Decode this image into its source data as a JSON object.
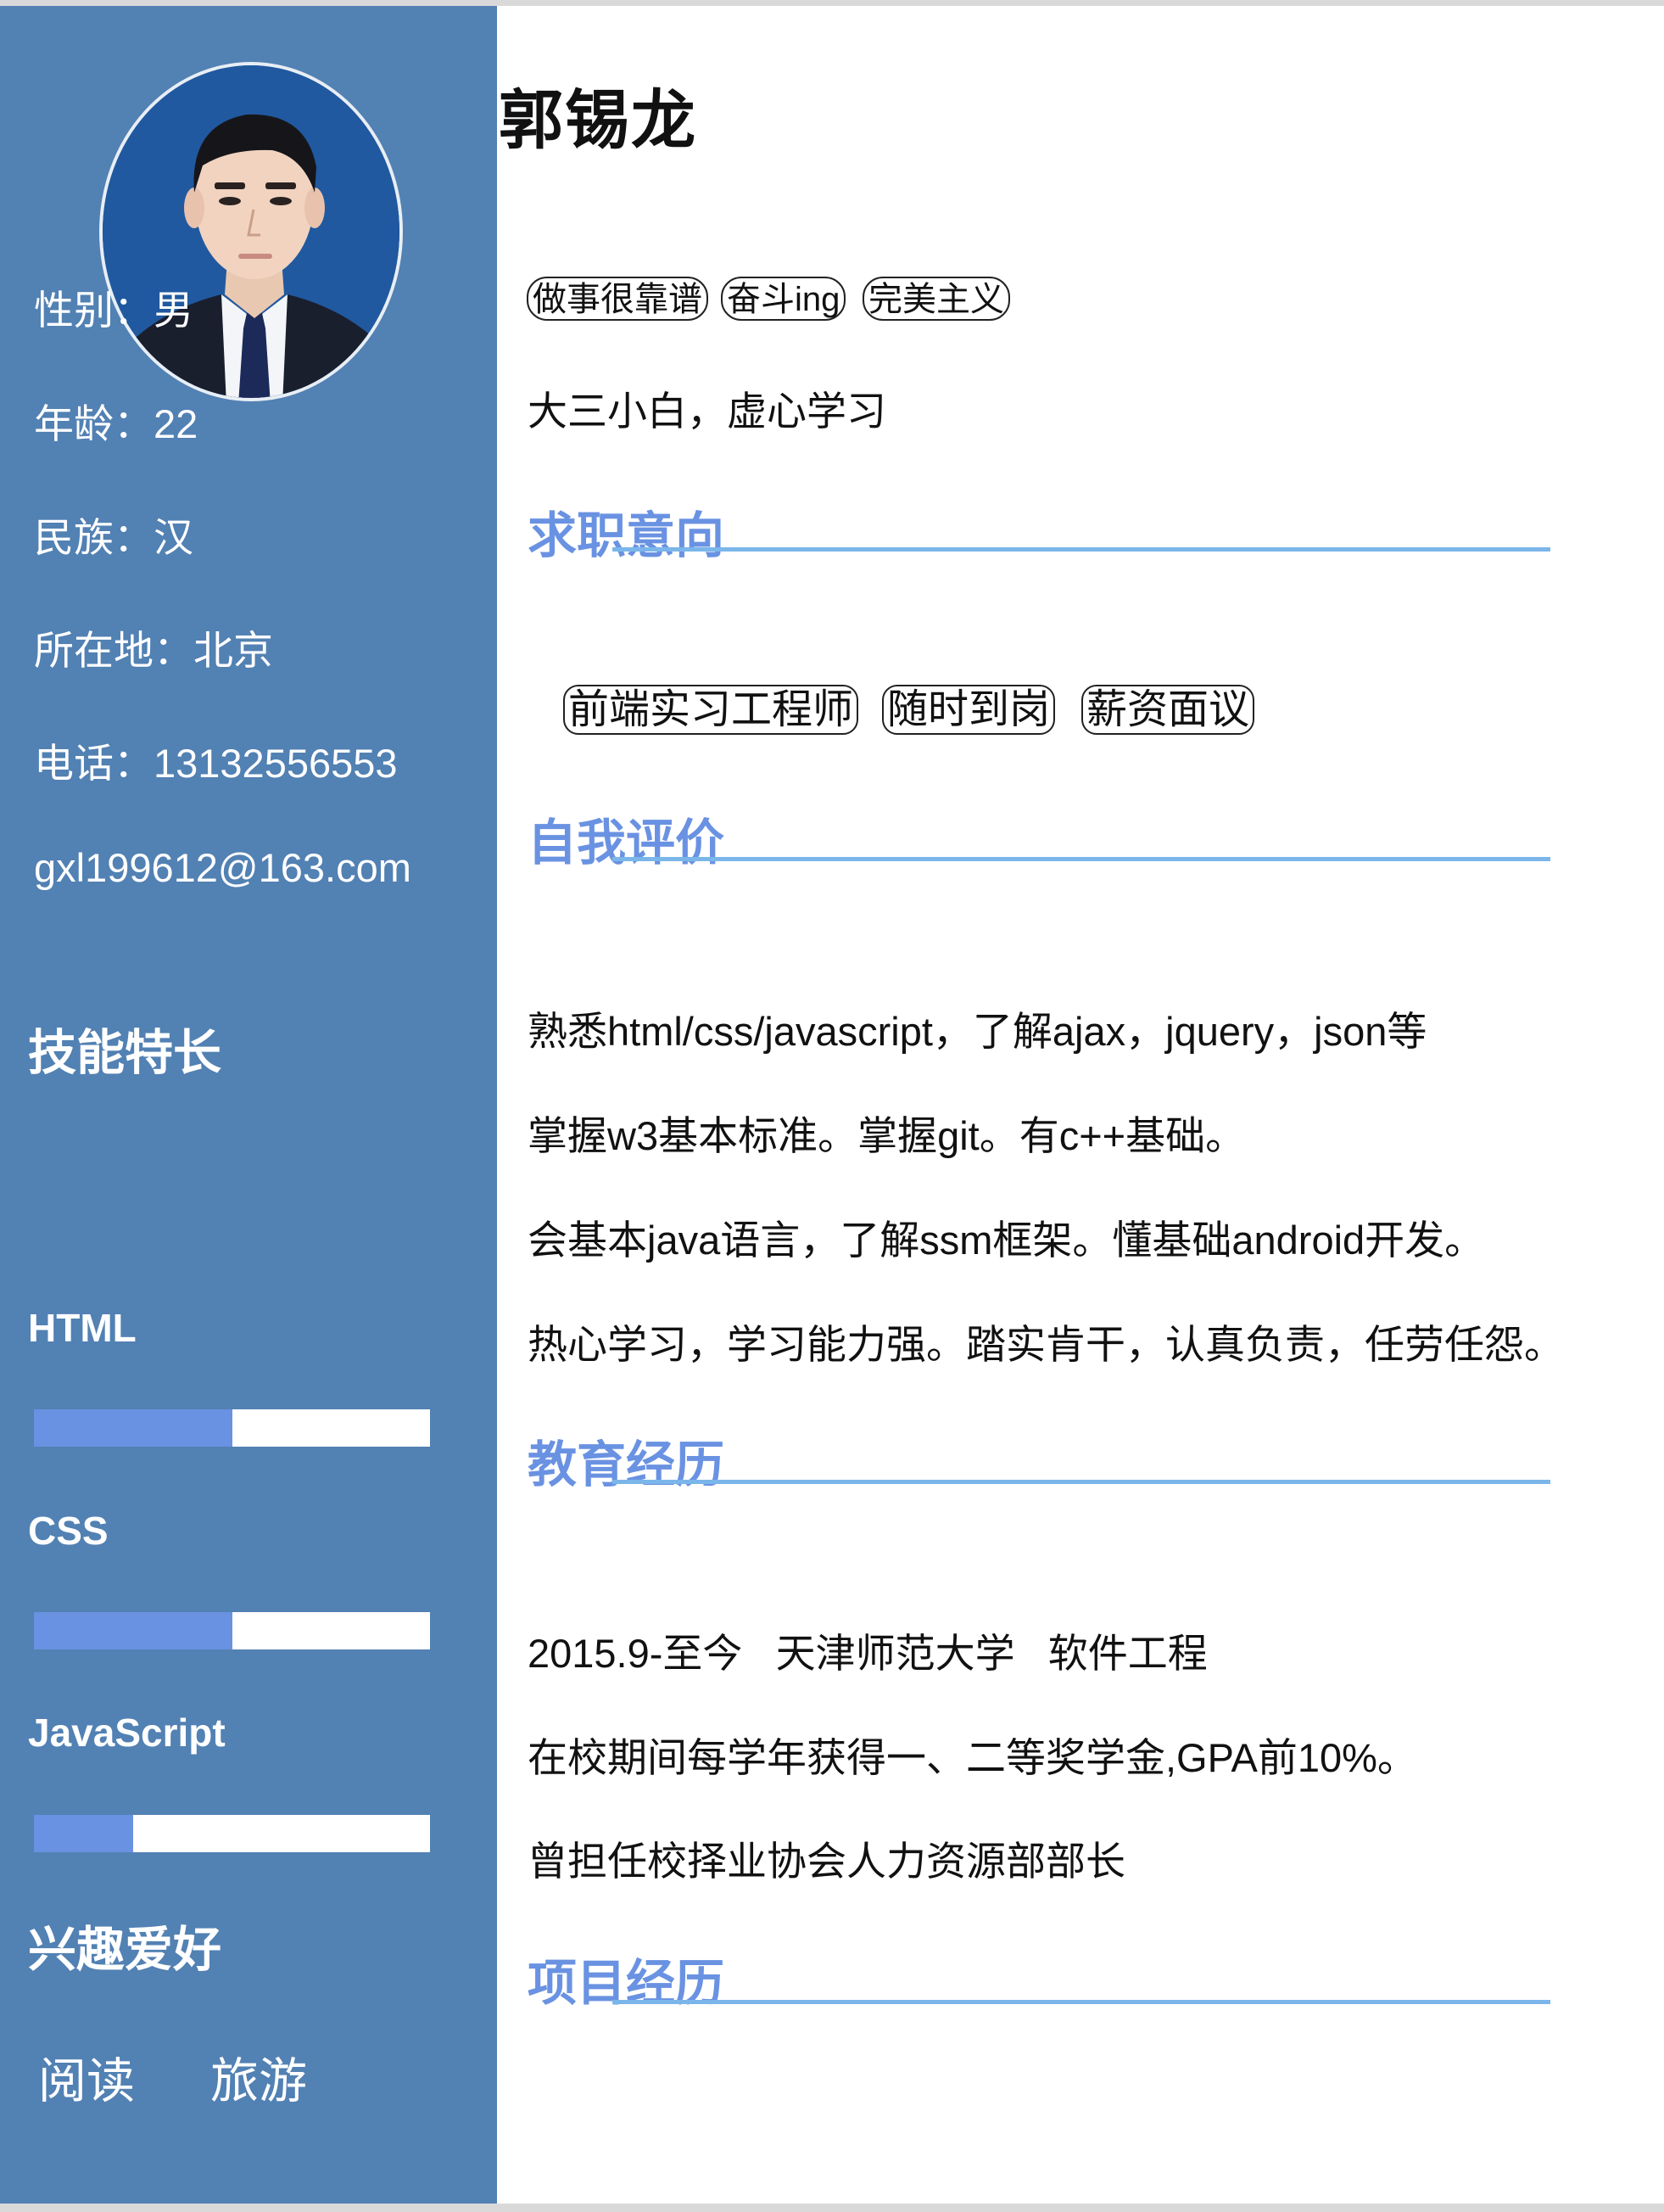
{
  "profile": {
    "name": "郭锡龙",
    "tags": [
      "做事很靠谱",
      "奋斗ing",
      "完美主义"
    ],
    "motto": "大三小白，虚心学习"
  },
  "sidebar": {
    "info": [
      "性别：男",
      "年龄：22",
      "民族：汉",
      "所在地：北京",
      "电话：13132556553",
      "gxl199612@163.com"
    ],
    "skills_title": "技能特长",
    "skills": [
      {
        "name": "HTML",
        "level": 0.5
      },
      {
        "name": "CSS",
        "level": 0.5
      },
      {
        "name": "JavaScript",
        "level": 0.25
      }
    ],
    "hobbies_title": "兴趣爱好",
    "hobbies": [
      "阅读",
      "旅游"
    ]
  },
  "sections": {
    "job_title": "求职意向",
    "job_tags": [
      "前端实习工程师",
      "随时到岗",
      "薪资面议"
    ],
    "self_title": "自我评价",
    "self_lines": [
      "熟悉html/css/javascript，了解ajax，jquery，json等",
      "掌握w3基本标准。掌握git。有c++基础。",
      "会基本java语言，了解ssm框架。懂基础android开发。",
      "热心学习，学习能力强。踏实肯干，认真负责，任劳任怨。"
    ],
    "edu_title": "教育经历",
    "edu_lines": [
      "2015.9-至今   天津师范大学   软件工程",
      "在校期间每学年获得一、二等奖学金,GPA前10%。",
      "曾担任校择业协会人力资源部部长"
    ],
    "project_title": "项目经历"
  },
  "colors": {
    "sidebar": "#5281b3",
    "accent": "#6a92e2",
    "underline": "#7bb6ea"
  }
}
